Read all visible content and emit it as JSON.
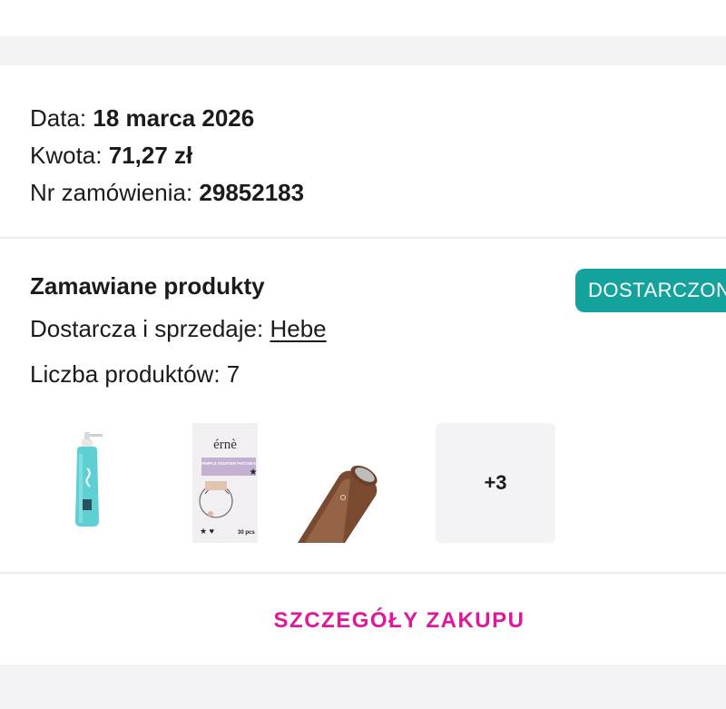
{
  "order": {
    "date_label": "Data:",
    "date_value": "18 marca 2026",
    "amount_label": "Kwota:",
    "amount_value": "71,27 zł",
    "order_no_label": "Nr zamówienia:",
    "order_no_value": "29852183"
  },
  "products": {
    "title": "Zamawiane produkty",
    "status": "DOSTARCZONE",
    "status_color": "#14a39c",
    "seller_label": "Dostarcza i sprzedaje:",
    "seller_name": "Hebe",
    "count_label": "Liczba produktów:",
    "count_value": "7",
    "thumbnails": [
      {
        "icon": "cleansing-gel-bottle-icon"
      },
      {
        "icon": "pimple-patches-pack-icon",
        "brand": "érnè",
        "label": "PIMPLE FIGHTER PATCHES",
        "qty": "30 pcs"
      },
      {
        "icon": "bronze-device-icon"
      }
    ],
    "more_label": "+3"
  },
  "actions": {
    "details_label": "SZCZEGÓŁY ZAKUPU",
    "accent_color": "#e0169b"
  }
}
